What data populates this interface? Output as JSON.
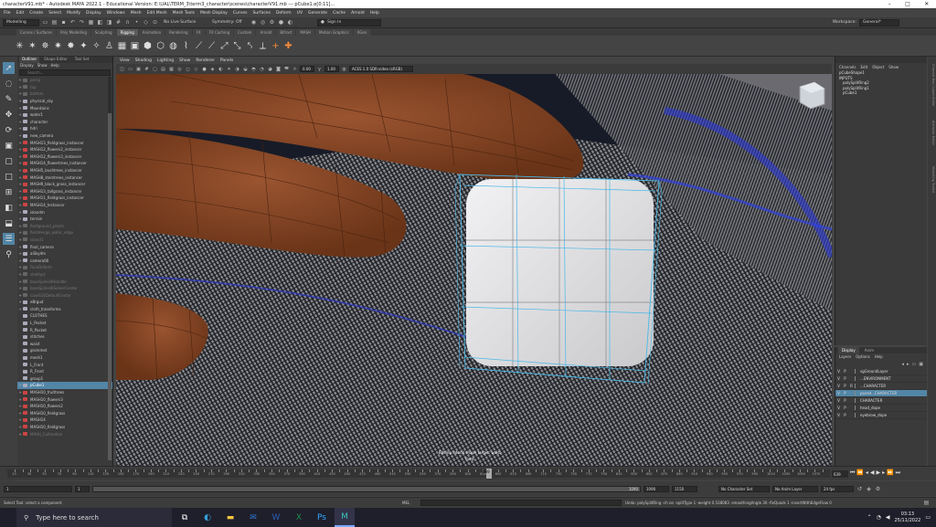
{
  "titlebar": {
    "title": "characterV91.mb* - Autodesk MAYA 2022.1 - Educational Version: E:\\UAL\\TERM_3\\term3_character\\scenes\\characterV91.mb  ---  pCube1.e[0:11]..."
  },
  "menubar": [
    "File",
    "Edit",
    "Create",
    "Select",
    "Modify",
    "Display",
    "Windows",
    "Mesh",
    "Edit Mesh",
    "Mesh Tools",
    "Mesh Display",
    "Curves",
    "Surfaces",
    "Deform",
    "UV",
    "Generate",
    "Cache",
    "Arnold",
    "Help"
  ],
  "statusline": {
    "mode": "Modelling",
    "live_surface": "No Live Surface",
    "symmetry": "Symmetry: Off",
    "signin": "Sign In",
    "workspace_label": "Workspace:",
    "workspace": "General*"
  },
  "shelf_tabs": [
    "Curves / Surfaces",
    "Poly Modelling",
    "Sculpting",
    "Rigging",
    "Animation",
    "Rendering",
    "FX",
    "FX Caching",
    "Custom",
    "Arnold",
    "Bifrost",
    "MASH",
    "Motion Graphics",
    "XGen"
  ],
  "shelf_tab_active": "Rigging",
  "outliner": {
    "tabs": [
      "Outliner",
      "Shape Editor",
      "Tool Set"
    ],
    "menu": [
      "Display",
      "Show",
      "Help"
    ],
    "search_placeholder": "Search...",
    "items": [
      {
        "label": "persp",
        "dim": true
      },
      {
        "label": "top",
        "dim": true
      },
      {
        "label": "bottom",
        "dim": true
      },
      {
        "label": "physical_sky"
      },
      {
        "label": "Mountains"
      },
      {
        "label": "water1"
      },
      {
        "label": "character"
      },
      {
        "label": "hdri"
      },
      {
        "label": "new_camera"
      },
      {
        "label": "MASH13_fieldgrass_instancer"
      },
      {
        "label": "MASH12_flowers2_instancer"
      },
      {
        "label": "MASH12_flowers3_instancer"
      },
      {
        "label": "MASH14_flowertrees_instancer"
      },
      {
        "label": "MASH5_bushtrees_instancer"
      },
      {
        "label": "MASH8_stemtrees_instancer"
      },
      {
        "label": "MASH9_black_grass_instancer"
      },
      {
        "label": "MASH13_tallgrass_instancer"
      },
      {
        "label": "MASH11_fieldgrass_instancer"
      },
      {
        "label": "MASH14_Instancer"
      },
      {
        "label": "islandm"
      },
      {
        "label": "terrain"
      },
      {
        "label": "fieldground_plants",
        "dim": true
      },
      {
        "label": "fieldmerge_water_edge",
        "dim": true
      },
      {
        "label": "island1",
        "dim": true
      },
      {
        "label": "final_camera"
      },
      {
        "label": "aiSkydm"
      },
      {
        "label": "camera00"
      },
      {
        "label": "FaceDeform",
        "dim": true
      },
      {
        "label": "shelfopt",
        "dim": true
      },
      {
        "label": "baseSplineIKHandle",
        "dim": true
      },
      {
        "label": "baseSplineIKSolverCenter",
        "dim": true
      },
      {
        "label": "caseS16DefaultCenter",
        "dim": true
      },
      {
        "label": "eBrgud"
      },
      {
        "label": "cloth_transforms"
      },
      {
        "label": "CLOTHES"
      },
      {
        "label": "L_Pocket"
      },
      {
        "label": "R_Pocket"
      },
      {
        "label": "stitches"
      },
      {
        "label": "waist"
      },
      {
        "label": "grommet"
      },
      {
        "label": "mesh1"
      },
      {
        "label": "L_Front"
      },
      {
        "label": "R_Front"
      },
      {
        "label": "group1"
      },
      {
        "label": "pCube1",
        "sel": true
      },
      {
        "label": "MASH10_fruittrees"
      },
      {
        "label": "MASH10_flowers3"
      },
      {
        "label": "MASH10_flowers2"
      },
      {
        "label": "MASH10_fieldgrass"
      },
      {
        "label": "MASH14"
      },
      {
        "label": "MASH10_fieldgrass"
      },
      {
        "label": "MASH_Cultivation",
        "dim": true
      }
    ]
  },
  "viewport": {
    "menu": [
      "View",
      "Shading",
      "Lighting",
      "Show",
      "Renderer",
      "Panels"
    ],
    "exposure": "0.00",
    "gamma": "1.00",
    "color_space": "ACES 1.0 SDR-video (sRGB)",
    "hud_line1": "Editing lateral shape target: waist",
    "hud_line2": "front"
  },
  "channelbox": {
    "menu": [
      "Channels",
      "Edit",
      "Object",
      "Show"
    ],
    "object": "pCubeShape1",
    "inputs_label": "INPUTS",
    "inputs": [
      "polySplitRing2",
      "polySplitRing1",
      "pCube1"
    ]
  },
  "layers": {
    "tabs": [
      "Display",
      "Anim"
    ],
    "menu": [
      "Layers",
      "Options",
      "Help"
    ],
    "rows": [
      {
        "v": "V",
        "p": "P",
        "r": "",
        "name": "sgGroundLayer"
      },
      {
        "v": "V",
        "p": "P",
        "r": "",
        "name": "...ENVIRONMENT"
      },
      {
        "v": "V",
        "p": "P",
        "r": "R",
        "name": "...CHARACTER"
      },
      {
        "v": "V",
        "p": "P",
        "r": "",
        "name": "posed...CHARACTER",
        "sel": true
      },
      {
        "v": "V",
        "p": "P",
        "r": "",
        "name": "CHARACTER"
      },
      {
        "v": "V",
        "p": "P",
        "r": "",
        "name": "head_dope"
      },
      {
        "v": "V",
        "p": "P",
        "r": "",
        "name": "eyebrow_dope"
      }
    ]
  },
  "timeline": {
    "ticks": [
      10,
      20,
      30,
      40,
      50,
      60,
      70,
      80,
      90,
      100,
      110,
      120,
      130,
      140,
      150,
      160,
      170,
      180,
      190,
      200,
      210,
      220,
      230,
      240,
      250,
      260,
      270,
      280,
      290,
      300,
      310,
      320,
      330,
      340,
      350,
      360,
      370,
      380,
      390,
      400,
      410,
      420,
      430,
      440,
      450,
      460,
      470,
      480,
      490,
      500,
      510,
      520,
      530,
      540,
      550,
      560,
      570,
      580,
      590,
      600,
      610,
      620,
      630,
      640,
      650,
      660,
      670,
      680,
      690,
      700,
      710,
      720,
      730,
      740,
      750,
      760,
      770,
      780,
      790,
      800,
      810,
      820,
      830,
      840,
      850,
      860,
      870,
      880,
      890,
      900,
      910,
      920,
      930,
      940,
      950,
      960,
      970,
      980,
      990,
      1000,
      1010,
      1020,
      1030,
      1040,
      1050,
      1060,
      1070,
      1080
    ],
    "current": "639",
    "current_on_ruler": "639"
  },
  "range": {
    "start": "1",
    "start2": "1",
    "end_anim": "1090",
    "end": "1090",
    "end2": "1150",
    "char_set": "No Character Set",
    "anim_layer": "No Anim Layer",
    "fps": "24 fps"
  },
  "cmdline": {
    "lang": "MEL",
    "result": "Undo: polySplitRing -ch on -splitType 1 -weight 0.538083 -smoothingAngle 30 -fixQuads 1 -insertWithEdgeFlow 0",
    "help": "Select Tool: select a component"
  },
  "taskbar": {
    "search": "Type here to search",
    "apps": [
      "task-view",
      "edge",
      "explorer",
      "outlook",
      "word",
      "excel",
      "photoshop",
      "maya"
    ],
    "time": "03:13",
    "date": "25/11/2022"
  },
  "colors": {
    "accent": "#5285a6",
    "skin": "#8b4a28",
    "cube": "#e2e2e4",
    "wire": "#4bb8e6"
  }
}
